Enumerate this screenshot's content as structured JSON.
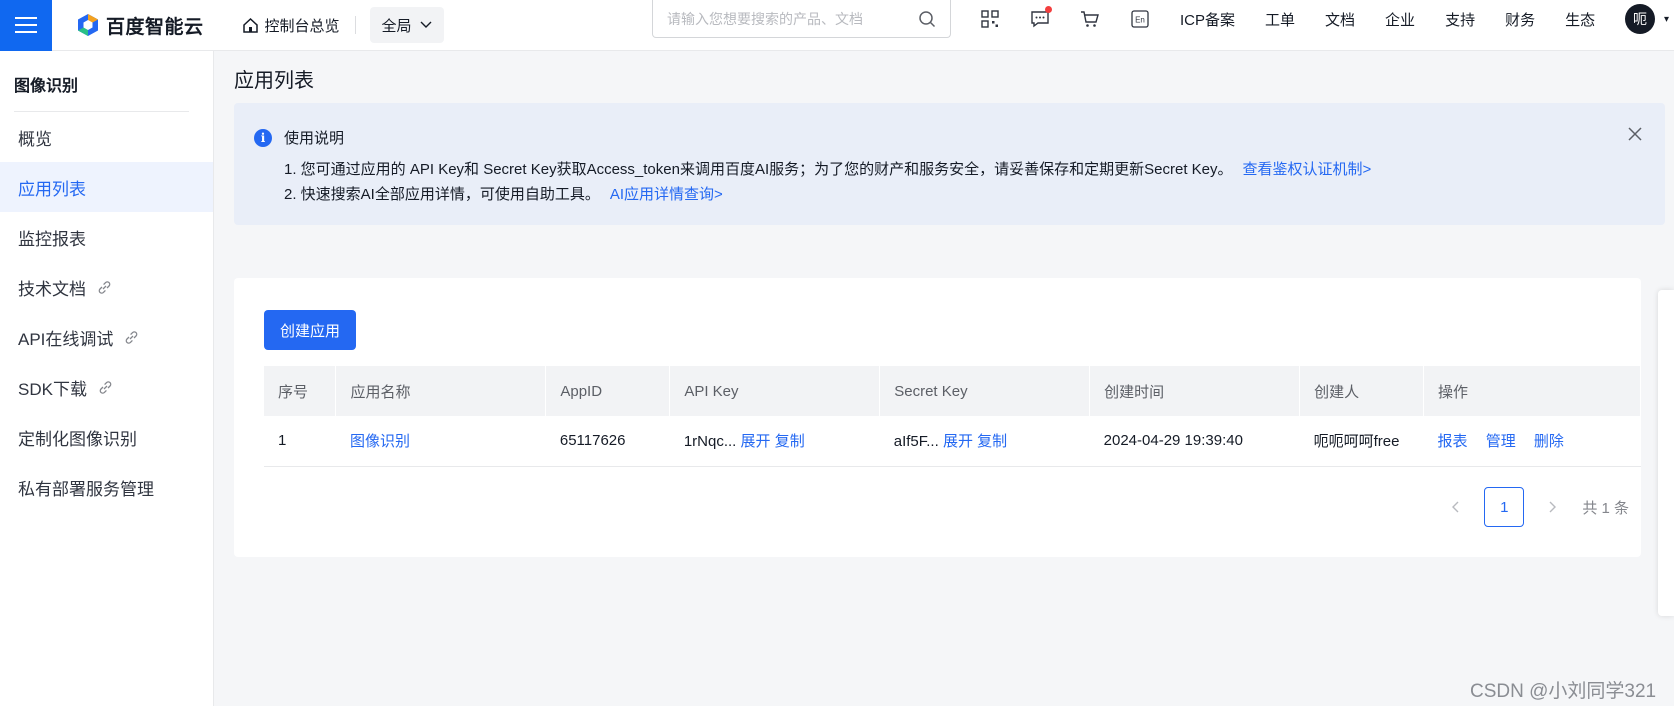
{
  "brand": {
    "logo_text": "百度智能云",
    "accent": "#2468f2",
    "menu_blue": "#1068f0"
  },
  "topbar": {
    "console_label": "控制台总览",
    "region_label": "全局",
    "search_placeholder": "请输入您想要搜索的产品、文档",
    "icons": [
      "qrcode-icon",
      "message-icon",
      "cart-icon",
      "language-en-icon"
    ],
    "lang_icon_text": "En",
    "nav": [
      "ICP备案",
      "工单",
      "文档",
      "企业",
      "支持",
      "财务",
      "生态"
    ],
    "avatar_text": "呃"
  },
  "sidebar": {
    "title": "图像识别",
    "items": [
      {
        "label": "概览",
        "link": false
      },
      {
        "label": "应用列表",
        "link": false,
        "active": true
      },
      {
        "label": "监控报表",
        "link": false
      },
      {
        "label": "技术文档",
        "link": true
      },
      {
        "label": "API在线调试",
        "link": true
      },
      {
        "label": "SDK下载",
        "link": true
      },
      {
        "label": "定制化图像识别",
        "link": false
      },
      {
        "label": "私有部署服务管理",
        "link": false
      }
    ]
  },
  "main": {
    "title": "应用列表",
    "notice": {
      "heading": "使用说明",
      "line1": "1. 您可通过应用的 API Key和 Secret Key获取Access_token来调用百度AI服务；为了您的财产和服务安全，请妥善保存和定期更新Secret Key。",
      "line1_link": "查看鉴权认证机制>",
      "line2": "2. 快速搜索AI全部应用详情，可使用自助工具。",
      "line2_link": "AI应用详情查询>"
    },
    "create_button": "创建应用",
    "table": {
      "columns": [
        "序号",
        "应用名称",
        "AppID",
        "API Key",
        "Secret Key",
        "创建时间",
        "创建人",
        "操作"
      ],
      "rows": [
        {
          "index": "1",
          "name": "图像识别",
          "app_id": "65117626",
          "api_key": "1rNqc...",
          "secret_key": "aIf5F...",
          "expand": "展开",
          "copy": "复制",
          "created_at": "2024-04-29 19:39:40",
          "creator": "呃呃呵呵free",
          "actions": [
            "报表",
            "管理",
            "删除"
          ]
        }
      ]
    },
    "pagination": {
      "current_page": "1",
      "total_text": "共 1 条"
    }
  },
  "watermark": "CSDN @小刘同学321"
}
